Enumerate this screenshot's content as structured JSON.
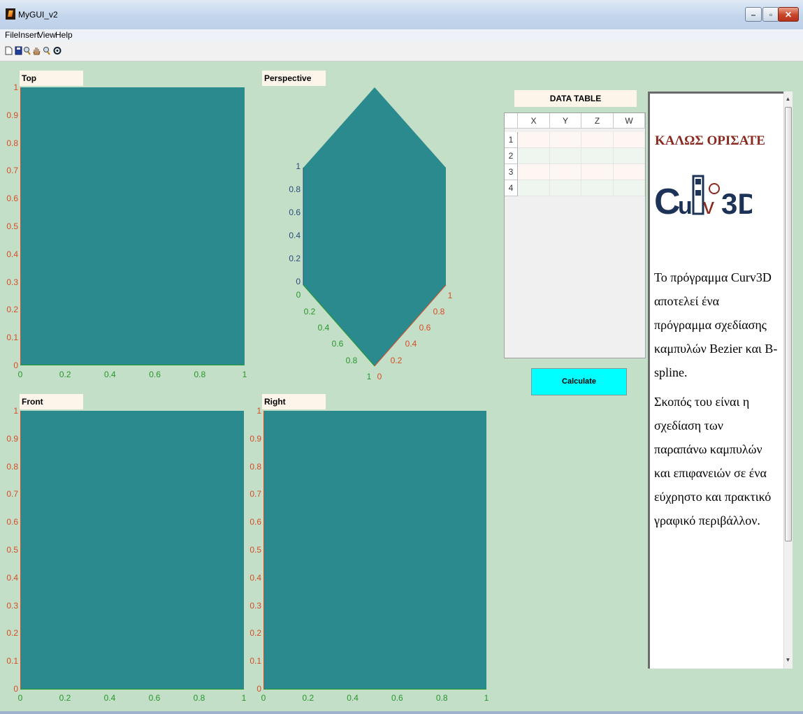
{
  "window": {
    "title": "MyGUI_v2",
    "minimize": "–",
    "maximize": "▫",
    "close": "✕"
  },
  "menu": [
    "File",
    "Insert",
    "View",
    "Help"
  ],
  "toolbar": [
    "new-file",
    "save",
    "zoom-in",
    "pan",
    "zoom-out",
    "rotate-3d"
  ],
  "plots": {
    "top": {
      "title": "Top",
      "yticks": [
        "1",
        "0.9",
        "0.8",
        "0.7",
        "0.6",
        "0.5",
        "0.4",
        "0.3",
        "0.2",
        "0.1",
        "0"
      ],
      "xticks": [
        "0",
        "0.2",
        "0.4",
        "0.6",
        "0.8",
        "1"
      ]
    },
    "front": {
      "title": "Front",
      "yticks": [
        "1",
        "0.9",
        "0.8",
        "0.7",
        "0.6",
        "0.5",
        "0.4",
        "0.3",
        "0.2",
        "0.1",
        "0"
      ],
      "xticks": [
        "0",
        "0.2",
        "0.4",
        "0.6",
        "0.8",
        "1"
      ]
    },
    "right": {
      "title": "Right",
      "yticks": [
        "1",
        "0.9",
        "0.8",
        "0.7",
        "0.6",
        "0.5",
        "0.4",
        "0.3",
        "0.2",
        "0.1",
        "0"
      ],
      "xticks": [
        "0",
        "0.2",
        "0.4",
        "0.6",
        "0.8",
        "1"
      ]
    },
    "perspective": {
      "title": "Perspective",
      "zticks": [
        "1",
        "0.8",
        "0.6",
        "0.4",
        "0.2",
        "0"
      ],
      "xticks": [
        "0",
        "0.2",
        "0.4",
        "0.6",
        "0.8",
        "1"
      ],
      "yticks": [
        "1",
        "0.8",
        "0.6",
        "0.4",
        "0.2",
        "0"
      ]
    }
  },
  "data_table": {
    "title": "DATA TABLE",
    "columns": [
      "X",
      "Y",
      "Z",
      "W"
    ],
    "rows": [
      "1",
      "2",
      "3",
      "4"
    ]
  },
  "calculate_label": "Calculate",
  "welcome": {
    "heading": "ΚΑΛΩΣ  ΟΡΙΣΑΤΕ",
    "logo_text": "CuRV3D",
    "paragraph1": "Το πρόγραμμα Curv3D αποτελεί ένα πρόγραμμα σχεδίασης καμπυλών Bezier  και  B-spline.",
    "paragraph2": "Σκοπός του είναι η σχεδίαση των παραπάνω καμπυλών και επιφανειών σε ένα εύχρηστο και πρακτικό γραφικό περιβάλλον."
  },
  "colors": {
    "axes_bg": "#2a8a8e",
    "figure_bg": "#c3dfc8",
    "calc_button": "#00ffff"
  }
}
